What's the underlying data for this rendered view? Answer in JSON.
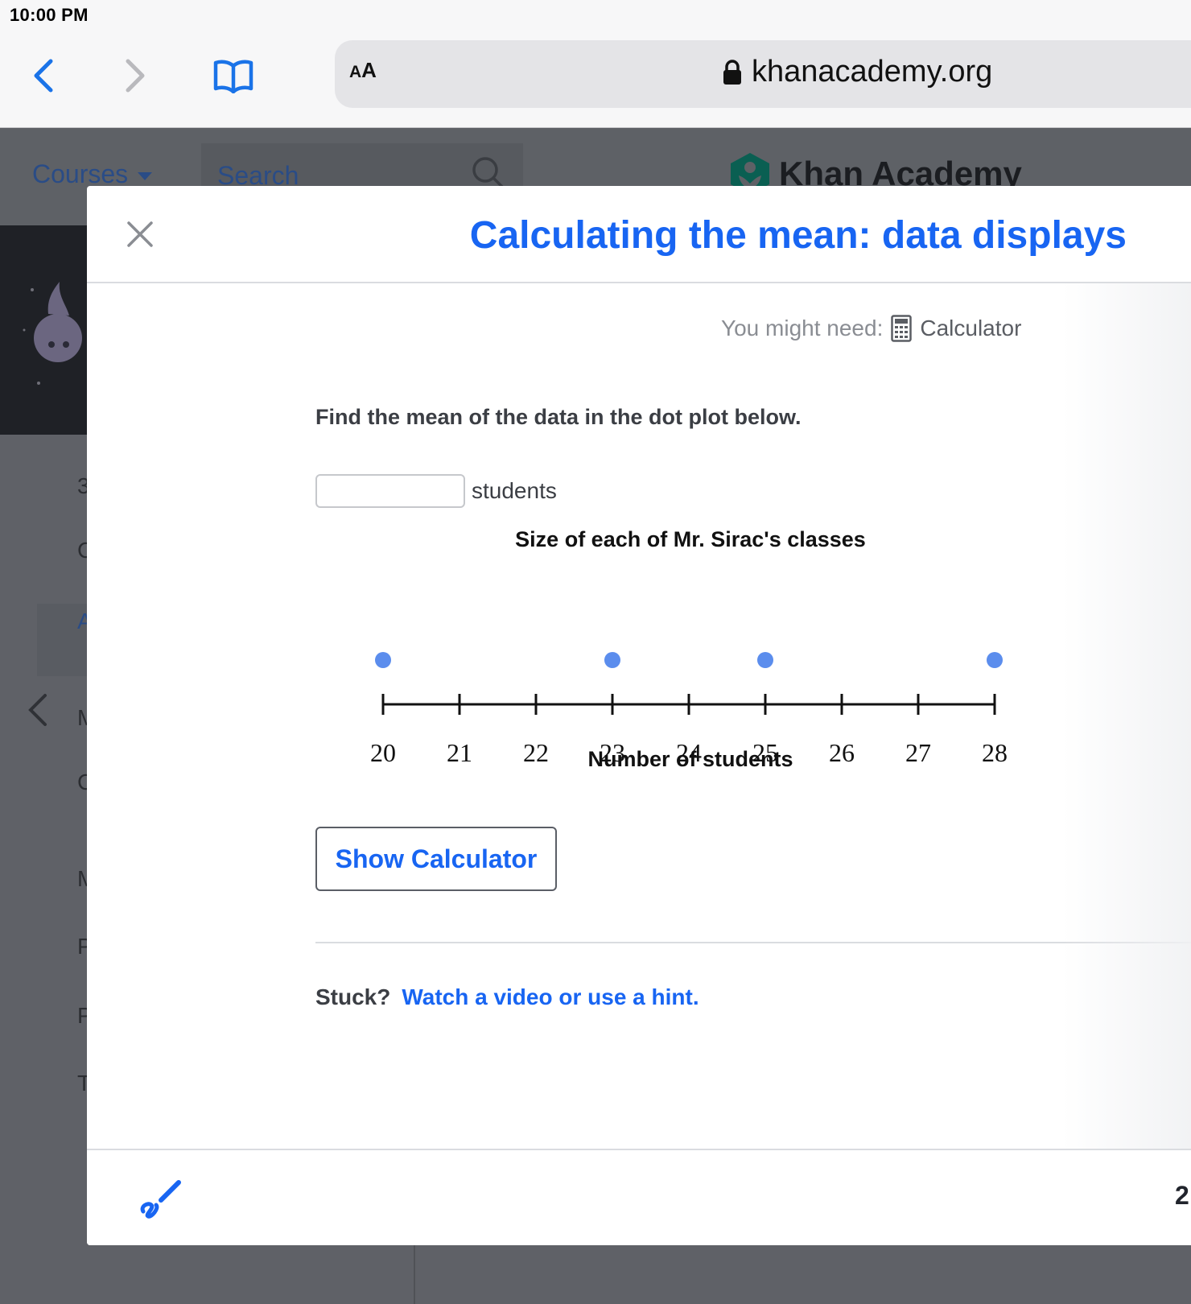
{
  "status_bar": {
    "time": "10:00 PM"
  },
  "browser": {
    "aa_small": "A",
    "aa_large": "A",
    "url": "khanacademy.org"
  },
  "background_page": {
    "courses": "Courses",
    "search_placeholder": "Search",
    "logo_text": "Khan Academy",
    "side_letters": [
      "3",
      "C",
      "A",
      "M",
      "C",
      "M",
      "P",
      "P",
      "T"
    ]
  },
  "modal": {
    "title": "Calculating the mean: data displays",
    "might_need_label": "You might need:",
    "might_need_tool": "Calculator",
    "question": "Find the mean of the data in the dot plot below.",
    "answer_value": "",
    "answer_unit": "students",
    "show_calculator_label": "Show Calculator",
    "stuck_label": "Stuck?",
    "hint_link": "Watch a video or use a hint.",
    "footer_progress": "2"
  },
  "colors": {
    "accent": "#1865f2",
    "dot": "#5b8ded",
    "text": "#3b3e44"
  },
  "chart_data": {
    "type": "scatter",
    "title": "Size of each of Mr. Sirac's classes",
    "xlabel": "Number of students",
    "ylabel": "",
    "xlim": [
      20,
      28
    ],
    "ticks": [
      20,
      21,
      22,
      23,
      24,
      25,
      26,
      27,
      28
    ],
    "tick_labels": [
      "20",
      "21",
      "22",
      "23",
      "24",
      "25",
      "26",
      "27",
      "28"
    ],
    "points": [
      {
        "x": 20,
        "count": 1
      },
      {
        "x": 23,
        "count": 1
      },
      {
        "x": 25,
        "count": 1
      },
      {
        "x": 28,
        "count": 1
      }
    ],
    "grid": false,
    "legend": "none"
  }
}
